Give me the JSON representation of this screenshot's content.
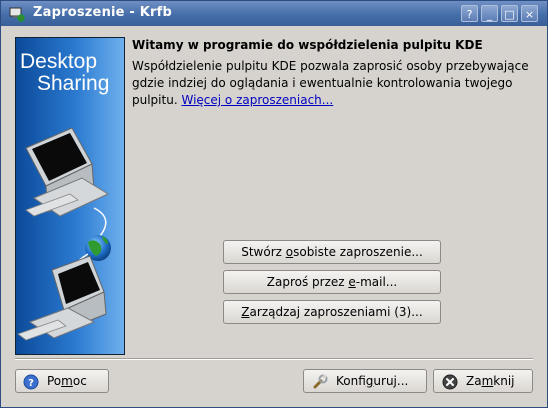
{
  "window": {
    "title": "Zaproszenie - Krfb",
    "controls": {
      "help": "?",
      "minimize": "_",
      "maximize": "□",
      "close": "×"
    }
  },
  "sidebar_image": {
    "line1": "Desktop",
    "line2": "Sharing"
  },
  "main": {
    "heading": "Witamy w programie do współdzielenia pulpitu KDE",
    "description": "Współdzielenie pulpitu KDE pozwala zaprosić osoby przebywające gdzie indziej do oglądania i ewentualnie kontrolowania twojego pulpitu.",
    "more_link": "Więcej o zaproszeniach..."
  },
  "actions": {
    "personal_prefix": "Stwórz ",
    "personal_mnemonic": "o",
    "personal_suffix": "sobiste zaproszenie...",
    "email_prefix": "Zaproś przez ",
    "email_mnemonic": "e",
    "email_suffix": "-mail...",
    "manage_mnemonic": "Z",
    "manage_suffix": "arządzaj zaproszeniami (3)..."
  },
  "footer": {
    "help_prefix": "Po",
    "help_mnemonic": "m",
    "help_suffix": "oc",
    "configure_prefix": "Konfi",
    "configure_mnemonic": "g",
    "configure_suffix": "uruj...",
    "close_prefix": "Za",
    "close_mnemonic": "m",
    "close_suffix": "knij"
  },
  "colors": {
    "titlebar": "#456ea9",
    "link": "#0000c0",
    "sidebar": "#1a5eb0"
  },
  "icons": {
    "app": "krfb-app-icon",
    "help": "help-icon",
    "configure": "wrench-icon",
    "close": "close-icon"
  }
}
